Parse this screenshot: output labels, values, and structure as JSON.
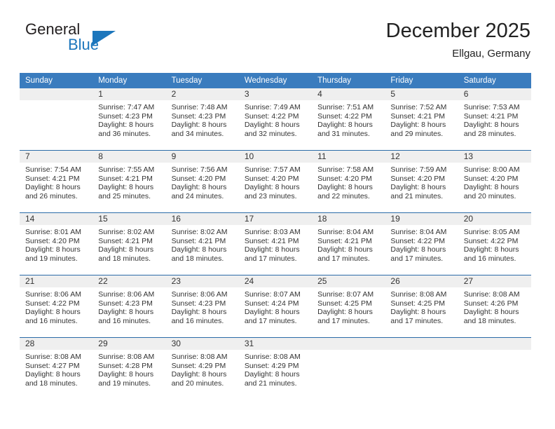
{
  "brand": {
    "name_part1": "General",
    "name_part2": "Blue",
    "triangle_icon": "triangle-icon",
    "accent_color": "#1c76bc"
  },
  "header": {
    "title": "December 2025",
    "subtitle": "Ellgau, Germany",
    "header_bg_color": "#3a7cbe",
    "row_divider_color": "#2b6ca8",
    "daynum_bg_color": "#efefef"
  },
  "weekday_headers": [
    "Sunday",
    "Monday",
    "Tuesday",
    "Wednesday",
    "Thursday",
    "Friday",
    "Saturday"
  ],
  "weeks": [
    {
      "days": [
        {
          "num": "",
          "sunrise": "",
          "sunset": "",
          "daylight1": "",
          "daylight2": ""
        },
        {
          "num": "1",
          "sunrise": "Sunrise: 7:47 AM",
          "sunset": "Sunset: 4:23 PM",
          "daylight1": "Daylight: 8 hours",
          "daylight2": "and 36 minutes."
        },
        {
          "num": "2",
          "sunrise": "Sunrise: 7:48 AM",
          "sunset": "Sunset: 4:23 PM",
          "daylight1": "Daylight: 8 hours",
          "daylight2": "and 34 minutes."
        },
        {
          "num": "3",
          "sunrise": "Sunrise: 7:49 AM",
          "sunset": "Sunset: 4:22 PM",
          "daylight1": "Daylight: 8 hours",
          "daylight2": "and 32 minutes."
        },
        {
          "num": "4",
          "sunrise": "Sunrise: 7:51 AM",
          "sunset": "Sunset: 4:22 PM",
          "daylight1": "Daylight: 8 hours",
          "daylight2": "and 31 minutes."
        },
        {
          "num": "5",
          "sunrise": "Sunrise: 7:52 AM",
          "sunset": "Sunset: 4:21 PM",
          "daylight1": "Daylight: 8 hours",
          "daylight2": "and 29 minutes."
        },
        {
          "num": "6",
          "sunrise": "Sunrise: 7:53 AM",
          "sunset": "Sunset: 4:21 PM",
          "daylight1": "Daylight: 8 hours",
          "daylight2": "and 28 minutes."
        }
      ]
    },
    {
      "days": [
        {
          "num": "7",
          "sunrise": "Sunrise: 7:54 AM",
          "sunset": "Sunset: 4:21 PM",
          "daylight1": "Daylight: 8 hours",
          "daylight2": "and 26 minutes."
        },
        {
          "num": "8",
          "sunrise": "Sunrise: 7:55 AM",
          "sunset": "Sunset: 4:21 PM",
          "daylight1": "Daylight: 8 hours",
          "daylight2": "and 25 minutes."
        },
        {
          "num": "9",
          "sunrise": "Sunrise: 7:56 AM",
          "sunset": "Sunset: 4:20 PM",
          "daylight1": "Daylight: 8 hours",
          "daylight2": "and 24 minutes."
        },
        {
          "num": "10",
          "sunrise": "Sunrise: 7:57 AM",
          "sunset": "Sunset: 4:20 PM",
          "daylight1": "Daylight: 8 hours",
          "daylight2": "and 23 minutes."
        },
        {
          "num": "11",
          "sunrise": "Sunrise: 7:58 AM",
          "sunset": "Sunset: 4:20 PM",
          "daylight1": "Daylight: 8 hours",
          "daylight2": "and 22 minutes."
        },
        {
          "num": "12",
          "sunrise": "Sunrise: 7:59 AM",
          "sunset": "Sunset: 4:20 PM",
          "daylight1": "Daylight: 8 hours",
          "daylight2": "and 21 minutes."
        },
        {
          "num": "13",
          "sunrise": "Sunrise: 8:00 AM",
          "sunset": "Sunset: 4:20 PM",
          "daylight1": "Daylight: 8 hours",
          "daylight2": "and 20 minutes."
        }
      ]
    },
    {
      "days": [
        {
          "num": "14",
          "sunrise": "Sunrise: 8:01 AM",
          "sunset": "Sunset: 4:20 PM",
          "daylight1": "Daylight: 8 hours",
          "daylight2": "and 19 minutes."
        },
        {
          "num": "15",
          "sunrise": "Sunrise: 8:02 AM",
          "sunset": "Sunset: 4:21 PM",
          "daylight1": "Daylight: 8 hours",
          "daylight2": "and 18 minutes."
        },
        {
          "num": "16",
          "sunrise": "Sunrise: 8:02 AM",
          "sunset": "Sunset: 4:21 PM",
          "daylight1": "Daylight: 8 hours",
          "daylight2": "and 18 minutes."
        },
        {
          "num": "17",
          "sunrise": "Sunrise: 8:03 AM",
          "sunset": "Sunset: 4:21 PM",
          "daylight1": "Daylight: 8 hours",
          "daylight2": "and 17 minutes."
        },
        {
          "num": "18",
          "sunrise": "Sunrise: 8:04 AM",
          "sunset": "Sunset: 4:21 PM",
          "daylight1": "Daylight: 8 hours",
          "daylight2": "and 17 minutes."
        },
        {
          "num": "19",
          "sunrise": "Sunrise: 8:04 AM",
          "sunset": "Sunset: 4:22 PM",
          "daylight1": "Daylight: 8 hours",
          "daylight2": "and 17 minutes."
        },
        {
          "num": "20",
          "sunrise": "Sunrise: 8:05 AM",
          "sunset": "Sunset: 4:22 PM",
          "daylight1": "Daylight: 8 hours",
          "daylight2": "and 16 minutes."
        }
      ]
    },
    {
      "days": [
        {
          "num": "21",
          "sunrise": "Sunrise: 8:06 AM",
          "sunset": "Sunset: 4:22 PM",
          "daylight1": "Daylight: 8 hours",
          "daylight2": "and 16 minutes."
        },
        {
          "num": "22",
          "sunrise": "Sunrise: 8:06 AM",
          "sunset": "Sunset: 4:23 PM",
          "daylight1": "Daylight: 8 hours",
          "daylight2": "and 16 minutes."
        },
        {
          "num": "23",
          "sunrise": "Sunrise: 8:06 AM",
          "sunset": "Sunset: 4:23 PM",
          "daylight1": "Daylight: 8 hours",
          "daylight2": "and 16 minutes."
        },
        {
          "num": "24",
          "sunrise": "Sunrise: 8:07 AM",
          "sunset": "Sunset: 4:24 PM",
          "daylight1": "Daylight: 8 hours",
          "daylight2": "and 17 minutes."
        },
        {
          "num": "25",
          "sunrise": "Sunrise: 8:07 AM",
          "sunset": "Sunset: 4:25 PM",
          "daylight1": "Daylight: 8 hours",
          "daylight2": "and 17 minutes."
        },
        {
          "num": "26",
          "sunrise": "Sunrise: 8:08 AM",
          "sunset": "Sunset: 4:25 PM",
          "daylight1": "Daylight: 8 hours",
          "daylight2": "and 17 minutes."
        },
        {
          "num": "27",
          "sunrise": "Sunrise: 8:08 AM",
          "sunset": "Sunset: 4:26 PM",
          "daylight1": "Daylight: 8 hours",
          "daylight2": "and 18 minutes."
        }
      ]
    },
    {
      "days": [
        {
          "num": "28",
          "sunrise": "Sunrise: 8:08 AM",
          "sunset": "Sunset: 4:27 PM",
          "daylight1": "Daylight: 8 hours",
          "daylight2": "and 18 minutes."
        },
        {
          "num": "29",
          "sunrise": "Sunrise: 8:08 AM",
          "sunset": "Sunset: 4:28 PM",
          "daylight1": "Daylight: 8 hours",
          "daylight2": "and 19 minutes."
        },
        {
          "num": "30",
          "sunrise": "Sunrise: 8:08 AM",
          "sunset": "Sunset: 4:29 PM",
          "daylight1": "Daylight: 8 hours",
          "daylight2": "and 20 minutes."
        },
        {
          "num": "31",
          "sunrise": "Sunrise: 8:08 AM",
          "sunset": "Sunset: 4:29 PM",
          "daylight1": "Daylight: 8 hours",
          "daylight2": "and 21 minutes."
        },
        {
          "num": "",
          "sunrise": "",
          "sunset": "",
          "daylight1": "",
          "daylight2": ""
        },
        {
          "num": "",
          "sunrise": "",
          "sunset": "",
          "daylight1": "",
          "daylight2": ""
        },
        {
          "num": "",
          "sunrise": "",
          "sunset": "",
          "daylight1": "",
          "daylight2": ""
        }
      ]
    }
  ]
}
